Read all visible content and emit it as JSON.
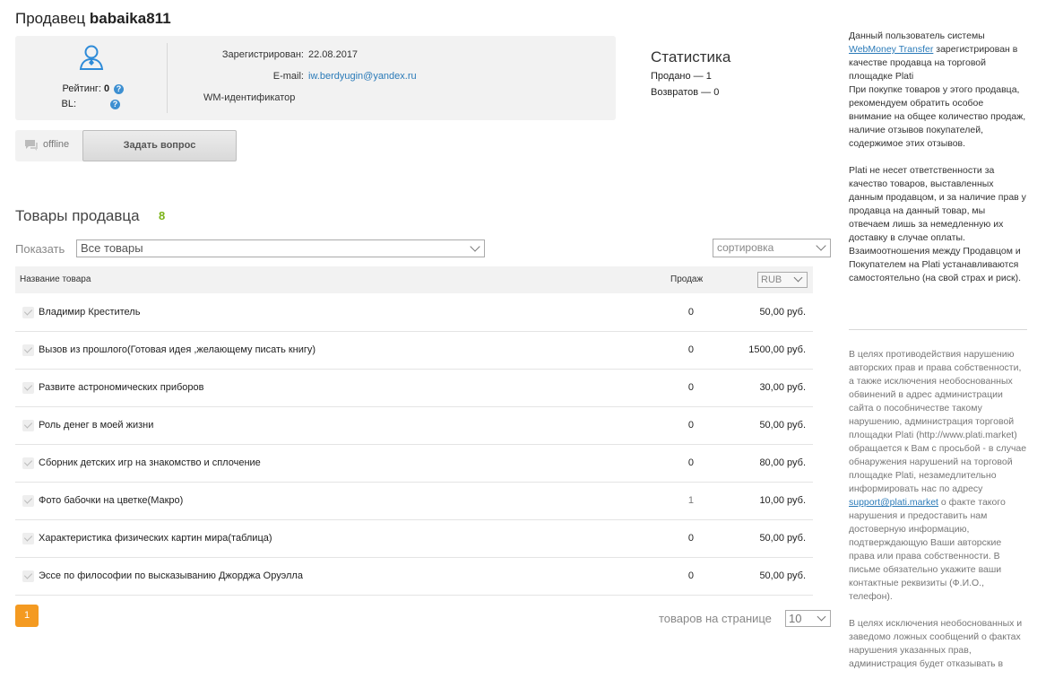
{
  "seller": {
    "title_prefix": "Продавец",
    "name": "babaika811"
  },
  "profile": {
    "rating_label": "Рейтинг:",
    "rating_value": "0",
    "bl_label": "BL:",
    "registered_label": "Зарегистрирован:",
    "registered_value": "22.08.2017",
    "email_label": "E-mail:",
    "email_value": "iw.berdyugin@yandex.ru",
    "wm_label": "WM-идентификатор"
  },
  "contact": {
    "status": "offline",
    "ask_button": "Задать вопрос"
  },
  "stats": {
    "title": "Статистика",
    "sold": "Продано — 1",
    "returns": "Возвратов — 0"
  },
  "goods": {
    "title": "Товары продавца",
    "count": "8",
    "show_label": "Показать",
    "filter_value": "Все товары",
    "sort_value": "сортировка",
    "col_name": "Название товара",
    "col_sales": "Продаж",
    "currency": "RUB",
    "items": [
      {
        "name": "Владимир Креститель",
        "sales": "0",
        "price": "50,00 руб."
      },
      {
        "name": "Вызов из прошлого(Готовая идея ,желающему писать книгу)",
        "sales": "0",
        "price": "1500,00 руб."
      },
      {
        "name": "Развите астрономических приборов",
        "sales": "0",
        "price": "30,00 руб."
      },
      {
        "name": "Роль денег в моей жизни",
        "sales": "0",
        "price": "50,00 руб."
      },
      {
        "name": "Сборник детских игр на знакомство и сплочение",
        "sales": "0",
        "price": "80,00 руб."
      },
      {
        "name": "Фото бабочки на цветке(Макро)",
        "sales": "1",
        "price": "10,00 руб."
      },
      {
        "name": "Характеристика физических картин мира(таблица)",
        "sales": "0",
        "price": "50,00 руб."
      },
      {
        "name": "Эссе по философии по высказыванию Джорджа Оруэлла",
        "sales": "0",
        "price": "50,00 руб."
      }
    ]
  },
  "pagination": {
    "current_page": "1",
    "per_page_label": "товаров на странице",
    "per_page_value": "10"
  },
  "sidebar": {
    "p1_a": "Данный пользователь системы",
    "p1_link": "WebMoney Transfer",
    "p1_b": "зарегистрирован в качестве продавца на торговой площадке Plati",
    "p2": "При покупке товаров у этого продавца, рекомендуем обратить особое внимание на общее количество продаж, наличие отзывов покупателей, содержимое этих отзывов.",
    "p3": "Plati не несет ответственности за качество товаров, выставленных данным продавцом, и за наличие прав у продавца на данный товар, мы отвечаем лишь за немедленную их доставку в случае оплаты. Взаимоотношения между Продавцом и Покупателем на Plati устанавливаются самостоятельно (на свой страх и риск).",
    "p4_a": "В целях противодействия нарушению авторских прав и права собственности, а также исключения необоснованных обвинений в адрес администрации сайта о пособничестве такому нарушению, администрация торговой площадки Plati (http://www.plati.market) обращается к Вам с просьбой - в случае обнаружения нарушений на торговой площадке Plati, незамедлительно информировать нас по адресу",
    "p4_link": "support@plati.market",
    "p4_b": "о факте такого нарушения и предоставить нам достоверную информацию, подтверждающую Ваши авторские права или права собственности. В письме обязательно укажите ваши контактные реквизиты (Ф.И.О., телефон).",
    "p5": "В целях исключения необоснованных и заведомо ложных сообщений о фактах нарушения указанных прав, администрация будет отказывать в"
  },
  "colors": {
    "accent_orange": "#f49a21",
    "count_green": "#7ab317",
    "link_blue": "#2a7ab8",
    "help_blue": "#3d8fd1"
  },
  "icons": [
    "user-icon",
    "help-icon",
    "chat-icon",
    "chevron-down-icon",
    "check-icon"
  ]
}
